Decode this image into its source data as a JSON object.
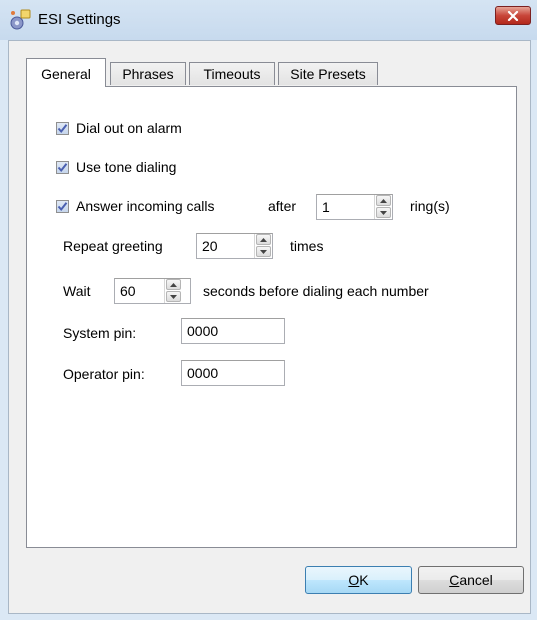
{
  "window": {
    "title": "ESI Settings",
    "icon": "esi-gear-icon",
    "close_icon": "close-icon"
  },
  "tabs": [
    {
      "label": "General",
      "active": true
    },
    {
      "label": "Phrases",
      "active": false
    },
    {
      "label": "Timeouts",
      "active": false
    },
    {
      "label": "Site Presets",
      "active": false
    }
  ],
  "general": {
    "dial_out": {
      "label": "Dial out on alarm",
      "checked": true
    },
    "tone_dialing": {
      "label": "Use tone dialing",
      "checked": true
    },
    "answer_calls": {
      "label": "Answer incoming calls",
      "checked": true,
      "after_label": "after",
      "rings_value": "1",
      "rings_suffix": "ring(s)"
    },
    "repeat_greeting": {
      "label": "Repeat greeting",
      "value": "20",
      "suffix": "times"
    },
    "wait": {
      "label": "Wait",
      "value": "60",
      "suffix": "seconds before dialing each number"
    },
    "system_pin": {
      "label": "System pin:",
      "value": "0000"
    },
    "operator_pin": {
      "label": "Operator pin:",
      "value": "0000"
    }
  },
  "buttons": {
    "ok": {
      "mnemonic": "O",
      "rest": "K"
    },
    "cancel": {
      "mnemonic": "C",
      "rest": "ancel"
    }
  },
  "colors": {
    "check_mark": "#4a5fb0",
    "close_button": "#c8463a",
    "default_button_border": "#3c7fb1"
  }
}
